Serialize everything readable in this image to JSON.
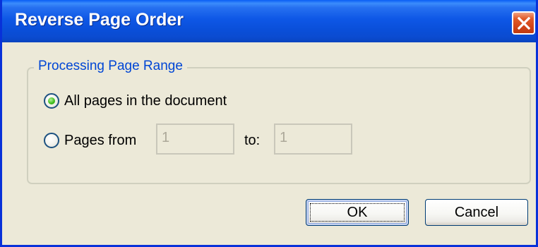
{
  "window": {
    "title": "Reverse Page Order"
  },
  "icons": {
    "close": "close-icon"
  },
  "group": {
    "legend": "Processing Page Range"
  },
  "options": {
    "all_pages_label": "All pages in the document",
    "pages_from_label": "Pages from",
    "to_label": "to:",
    "selected": "all_pages"
  },
  "fields": {
    "from_value": "1",
    "to_value": "1"
  },
  "buttons": {
    "ok_label": "OK",
    "cancel_label": "Cancel"
  },
  "colors": {
    "title_bar": "#0a4fd9",
    "close_button": "#d04418",
    "dialog_background": "#ece9d8",
    "group_legend": "#0046d5",
    "radio_selected": "#42c020"
  }
}
